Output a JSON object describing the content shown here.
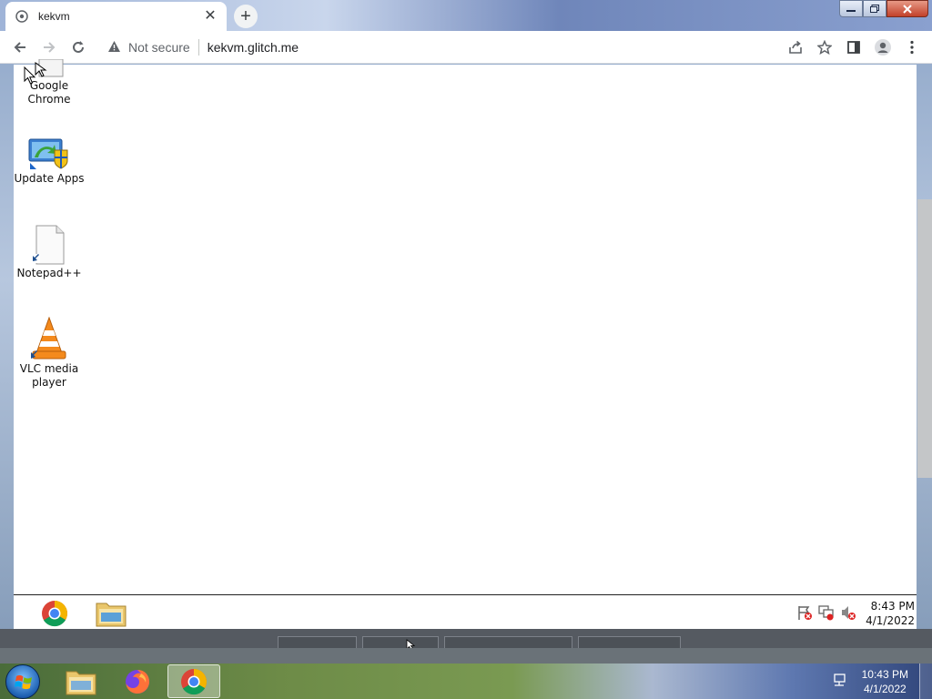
{
  "browser": {
    "tab_title": "kekvm",
    "tab_close": "✕",
    "new_tab": "+",
    "security_label": "Not secure",
    "url": "kekvm.glitch.me"
  },
  "remote_desktop": {
    "icons": [
      {
        "label": "Google Chrome",
        "icon": "chrome-shortcut-icon"
      },
      {
        "label": "Update Apps",
        "icon": "update-apps-icon"
      },
      {
        "label": "Notepad++",
        "icon": "notepad-icon"
      },
      {
        "label": "VLC media player",
        "icon": "vlc-icon"
      }
    ],
    "taskbar": {
      "time": "8:43 PM",
      "date": "4/1/2022"
    }
  },
  "host_taskbar": {
    "time": "10:43 PM",
    "date": "4/1/2022"
  }
}
